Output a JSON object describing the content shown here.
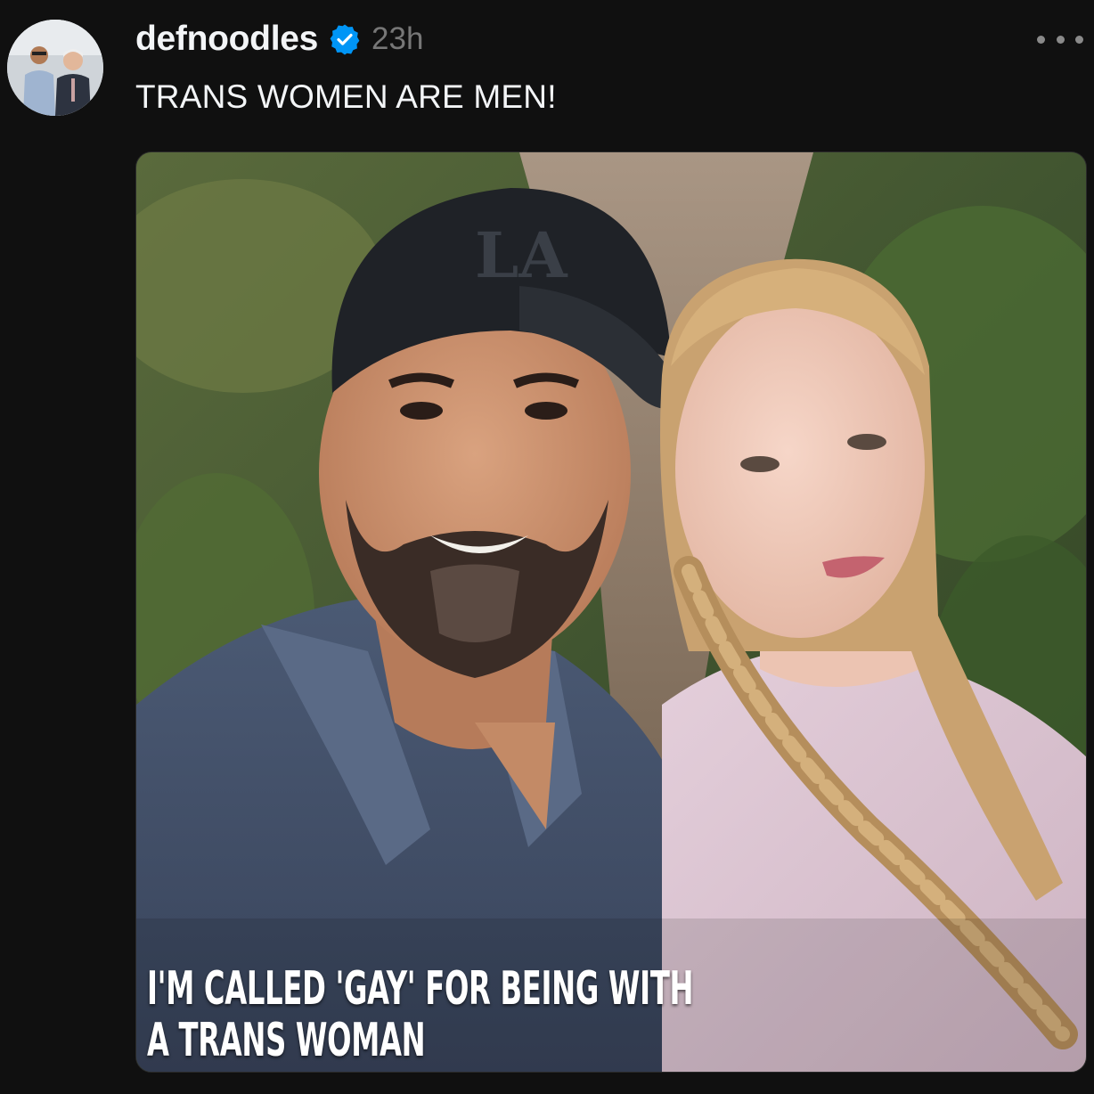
{
  "post": {
    "username": "defnoodles",
    "timestamp": "23h",
    "caption": "TRANS WOMEN ARE MEN!",
    "image_overlay_lines": [
      "I'M CALLED 'GAY' FOR BEING WITH",
      "A TRANS WOMAN"
    ],
    "cap_logo_text": "LA"
  },
  "icons": {
    "verified": "verified-badge-icon",
    "more": "more-options-icon"
  },
  "colors": {
    "background": "#101010",
    "text_primary": "#f3f5f7",
    "text_secondary": "#777777",
    "verified_blue": "#0095f6"
  }
}
